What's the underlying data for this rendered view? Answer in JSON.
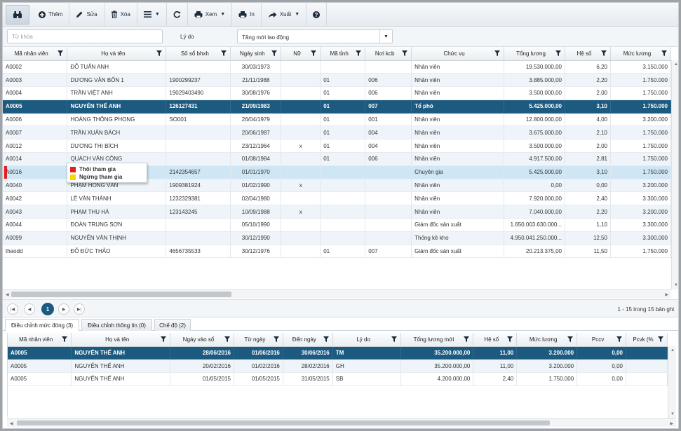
{
  "toolbar": {
    "buttons": [
      {
        "label": "Thêm"
      },
      {
        "label": "Sửa"
      },
      {
        "label": "Xóa"
      },
      {
        "label": "Xem"
      },
      {
        "label": "In"
      },
      {
        "label": "Xuất"
      }
    ]
  },
  "filters": {
    "search_placeholder": "Từ khóa",
    "reason_label": "Lý do",
    "reason_value": "Tăng mới lao động"
  },
  "employees": {
    "columns": [
      "Mã nhân viên",
      "Họ và tên",
      "Số sổ bhxh",
      "Ngày sinh",
      "Nữ",
      "Mã tỉnh",
      "Nơi kcb",
      "Chức vụ",
      "Tổng lương",
      "Hệ số",
      "Mức lương"
    ],
    "rows": [
      [
        "A0002",
        "ĐỖ TUẤN ANH",
        "",
        "30/03/1973",
        "",
        "",
        "",
        "Nhân viên",
        "19.530.000,00",
        "6,20",
        "3.150.000"
      ],
      [
        "A0003",
        "DƯƠNG VĂN BỐN 1",
        "1900299237",
        "21/11/1988",
        "",
        "01",
        "006",
        "Nhân viên",
        "3.885.000,00",
        "2,20",
        "1.750.000"
      ],
      [
        "A0004",
        "TRẦN VIỆT ANH",
        "19029403490",
        "30/08/1976",
        "",
        "01",
        "006",
        "Nhân viên",
        "3.500.000,00",
        "2,00",
        "1.750.000"
      ],
      [
        "A0005",
        "NGUYỄN THẾ ANH",
        "126127431",
        "21/09/1983",
        "",
        "01",
        "007",
        "Tổ phó",
        "5.425.000,00",
        "3,10",
        "1.750.000"
      ],
      [
        "A0006",
        "HOÀNG THÔNG PHONG",
        "SO001",
        "26/04/1979",
        "",
        "01",
        "001",
        "Nhân viên",
        "12.800.000,00",
        "4,00",
        "3.200.000"
      ],
      [
        "A0007",
        "TRẦN XUÂN BÁCH",
        "",
        "20/06/1987",
        "",
        "01",
        "004",
        "Nhân viên",
        "3.675.000,00",
        "2,10",
        "1.750.000"
      ],
      [
        "A0012",
        "DƯƠNG THỊ BÍCH",
        "",
        "23/12/1964",
        "x",
        "01",
        "004",
        "Nhân viên",
        "3.500.000,00",
        "2,00",
        "1.750.000"
      ],
      [
        "A0014",
        "QUÁCH VĂN CÔNG",
        "",
        "01/08/1984",
        "",
        "01",
        "006",
        "Nhân viên",
        "4.917.500,00",
        "2,81",
        "1.750.000"
      ],
      [
        "A0016",
        "",
        "2142354657",
        "01/01/1970",
        "",
        "",
        "",
        "Chuyên gia",
        "5.425.000,00",
        "3,10",
        "1.750.000"
      ],
      [
        "A0040",
        "PHẠM HỒNG VÂN",
        "1909381924",
        "01/02/1990",
        "x",
        "",
        "",
        "Nhân viên",
        "0,00",
        "0,00",
        "3.200.000"
      ],
      [
        "A0042",
        "LÊ VĂN THÀNH",
        "1232329381",
        "02/04/1980",
        "",
        "",
        "",
        "Nhân viên",
        "7.920.000,00",
        "2,40",
        "3.300.000"
      ],
      [
        "A0043",
        "PHẠM THU HÀ",
        "123143245",
        "10/09/1988",
        "x",
        "",
        "",
        "Nhân viên",
        "7.040.000,00",
        "2,20",
        "3.200.000"
      ],
      [
        "A0044",
        "ĐOÀN TRUNG SƠN",
        "",
        "05/10/1990",
        "",
        "",
        "",
        "Giám đốc sản xuất",
        "1.650.003.630.000...",
        "1,10",
        "3.300.000"
      ],
      [
        "A0099",
        "NGUYỄN VĂN THỊNH",
        "",
        "30/12/1990",
        "",
        "",
        "",
        "Thống kê kho",
        "4.950.041.250.000...",
        "12,50",
        "3.300.000"
      ],
      [
        "thaodd",
        "ĐỖ ĐỨC THẢO",
        "4656735533",
        "30/12/1976",
        "",
        "01",
        "007",
        "Giám đốc sản xuất",
        "20.213.375,00",
        "11,50",
        "1.750.000"
      ]
    ]
  },
  "status_tooltip": {
    "items": [
      {
        "label": "Thôi tham gia",
        "color": "#e02020"
      },
      {
        "label": "Ngừng tham gia",
        "color": "#f5d800"
      }
    ]
  },
  "pager": {
    "current_page": "1",
    "info": "1 - 15 trong 15 bản ghi"
  },
  "tabs": [
    {
      "label": "Điều chỉnh mức đóng (3)"
    },
    {
      "label": "Điều chỉnh thông tin (0)"
    },
    {
      "label": "Chế độ (2)"
    }
  ],
  "adjustments": {
    "columns": [
      "Mã nhân viên",
      "Họ và tên",
      "Ngày vào sổ",
      "Từ ngày",
      "Đến ngày",
      "Lý do",
      "Tổng lương mới",
      "Hệ số",
      "Mức lương",
      "Pccv",
      "Pcvk (%"
    ],
    "rows": [
      [
        "A0005",
        "NGUYỄN THẾ ANH",
        "28/06/2016",
        "01/06/2016",
        "30/06/2016",
        "TM",
        "35.200.000,00",
        "11,00",
        "3.200.000",
        "0,00",
        ""
      ],
      [
        "A0005",
        "NGUYỄN THẾ ANH",
        "20/02/2016",
        "01/02/2016",
        "28/02/2016",
        "GH",
        "35.200.000,00",
        "11,00",
        "3.200.000",
        "0,00",
        ""
      ],
      [
        "A0005",
        "NGUYỄN THẾ ANH",
        "01/05/2015",
        "01/05/2015",
        "31/05/2015",
        "SB",
        "4.200.000,00",
        "2,40",
        "1.750.000",
        "0,00",
        ""
      ]
    ]
  },
  "colors": {
    "selected_row": "#1d5a80",
    "hover_row": "#cfe6f5",
    "alt_row": "#eef4f9"
  }
}
